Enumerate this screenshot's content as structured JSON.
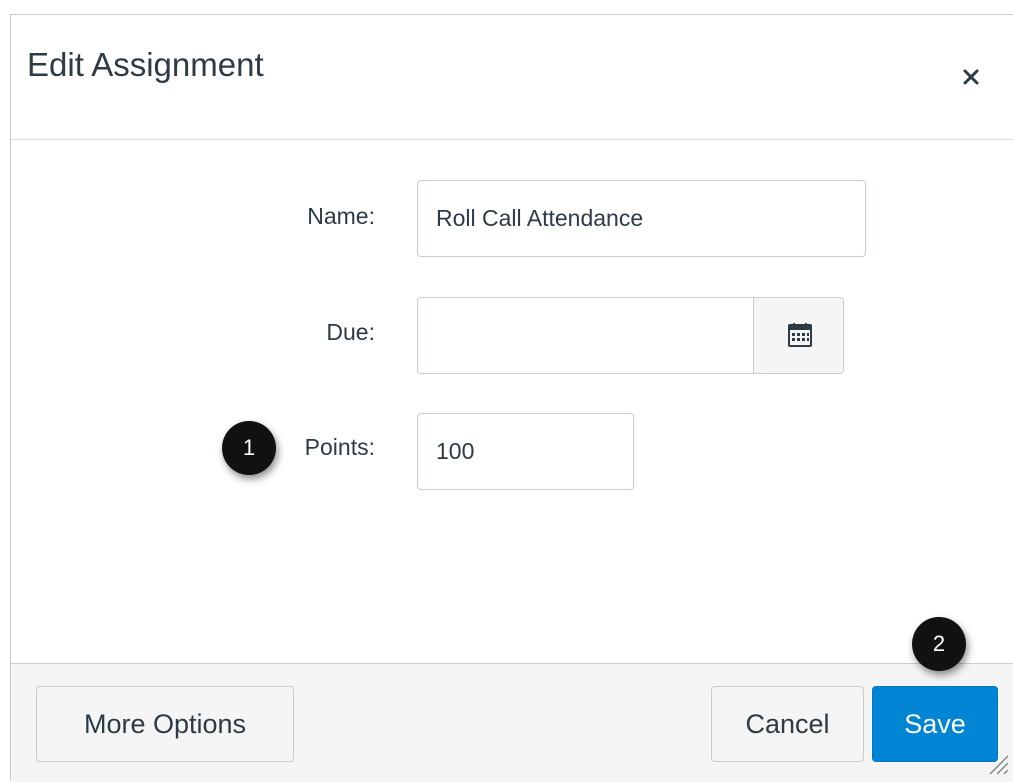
{
  "dialog": {
    "title": "Edit Assignment",
    "close_icon": "close-icon"
  },
  "form": {
    "name": {
      "label": "Name:",
      "value": "Roll Call Attendance"
    },
    "due": {
      "label": "Due:",
      "value": "",
      "calendar_icon": "calendar-icon"
    },
    "points": {
      "label": "Points:",
      "value": "100"
    }
  },
  "footer": {
    "more_options_label": "More Options",
    "cancel_label": "Cancel",
    "save_label": "Save"
  },
  "callouts": [
    {
      "number": "1"
    },
    {
      "number": "2"
    }
  ],
  "colors": {
    "primary": "#0084d4",
    "text": "#2d3b45",
    "border": "#c7cdd1",
    "footer_bg": "#f5f5f5",
    "badge_bg": "#111111"
  }
}
